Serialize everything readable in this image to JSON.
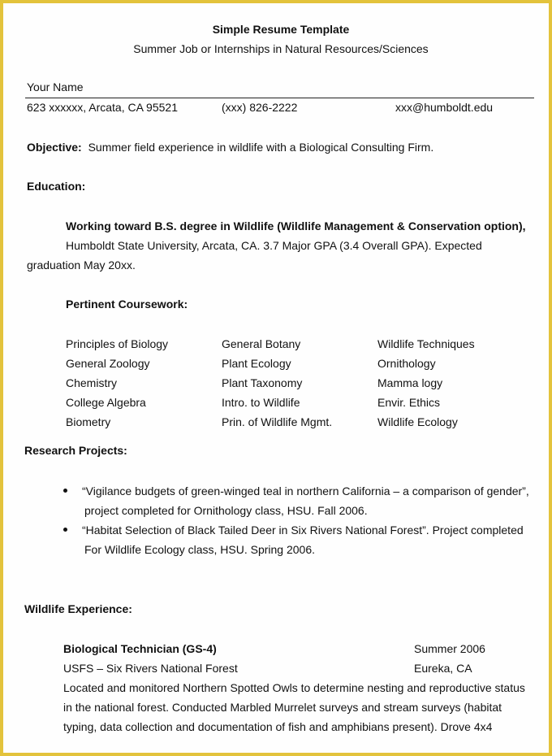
{
  "document": {
    "title": "Simple Resume Template",
    "subtitle": "Summer Job or Internships in Natural Resources/Sciences"
  },
  "contact": {
    "name": "Your Name",
    "address": "623 xxxxxx, Arcata, CA 95521",
    "phone": "(xxx) 826-2222",
    "email": "xxx@humboldt.edu"
  },
  "objective": {
    "label": "Objective:",
    "text": "Summer field experience in wildlife with a Biological Consulting Firm."
  },
  "education": {
    "heading": "Education:",
    "degree": "Working toward B.S. degree in Wildlife (Wildlife Management & Conservation option),",
    "details_line1": "Humboldt State University, Arcata, CA.  3.7 Major GPA (3.4 Overall GPA).  Expected",
    "details_line2": "graduation May 20xx.",
    "coursework_heading": "Pertinent Coursework:",
    "coursework_columns": [
      [
        "Principles of Biology",
        "General Zoology",
        "Chemistry",
        "College Algebra",
        "Biometry"
      ],
      [
        "General Botany",
        "Plant Ecology",
        "Plant Taxonomy",
        "Intro. to Wildlife",
        "Prin. of Wildlife Mgmt."
      ],
      [
        "Wildlife Techniques",
        "Ornithology",
        "Mamma logy",
        "Envir. Ethics",
        "Wildlife Ecology"
      ]
    ]
  },
  "research": {
    "heading": "Research Projects:",
    "items": [
      {
        "line1": "“Vigilance budgets of green-winged teal in northern California – a comparison of gender”,",
        "line2": "project completed for Ornithology class, HSU.  Fall 2006."
      },
      {
        "line1": "“Habitat Selection of Black Tailed Deer in Six Rivers National Forest”. Project completed",
        "line2": "For Wildlife Ecology class, HSU.  Spring 2006."
      }
    ]
  },
  "experience": {
    "heading": "Wildlife Experience:",
    "jobs": [
      {
        "title": "Biological Technician (GS-4)",
        "date": "Summer 2006",
        "employer": "USFS – Six Rivers National Forest",
        "location": "Eureka, CA",
        "description_lines": [
          "Located and monitored Northern Spotted Owls to determine nesting and reproductive status",
          "in the national forest.  Conducted Marbled Murrelet surveys and stream surveys (habitat",
          "typing, data collection and documentation of fish and amphibians present).  Drove 4x4"
        ]
      }
    ]
  },
  "colors": {
    "border": "#e3c33c",
    "page": "#fefefe",
    "text": "#111111"
  }
}
